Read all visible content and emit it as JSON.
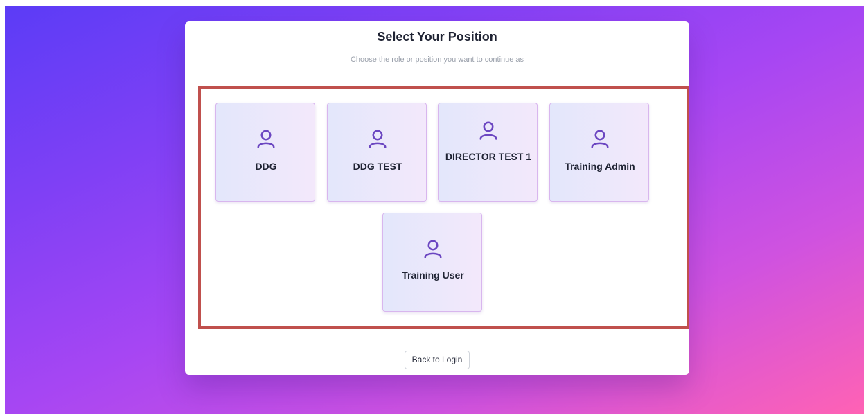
{
  "page": {
    "title": "Select Your Position",
    "subtitle": "Choose the role or position you want to continue as"
  },
  "positions": [
    {
      "label": "DDG",
      "icon": "user-icon"
    },
    {
      "label": "DDG TEST",
      "icon": "user-icon"
    },
    {
      "label": "DIRECTOR TEST 1",
      "icon": "user-icon"
    },
    {
      "label": "Training Admin",
      "icon": "user-icon"
    },
    {
      "label": "Training User",
      "icon": "user-icon"
    }
  ],
  "footer": {
    "back_label": "Back to Login"
  },
  "colors": {
    "gradient_start": "#5b3cf6",
    "gradient_end": "#ff62b4",
    "icon": "#6b46c1",
    "highlight_border": "#c0504d",
    "tile_border": "#d8b6ee"
  }
}
